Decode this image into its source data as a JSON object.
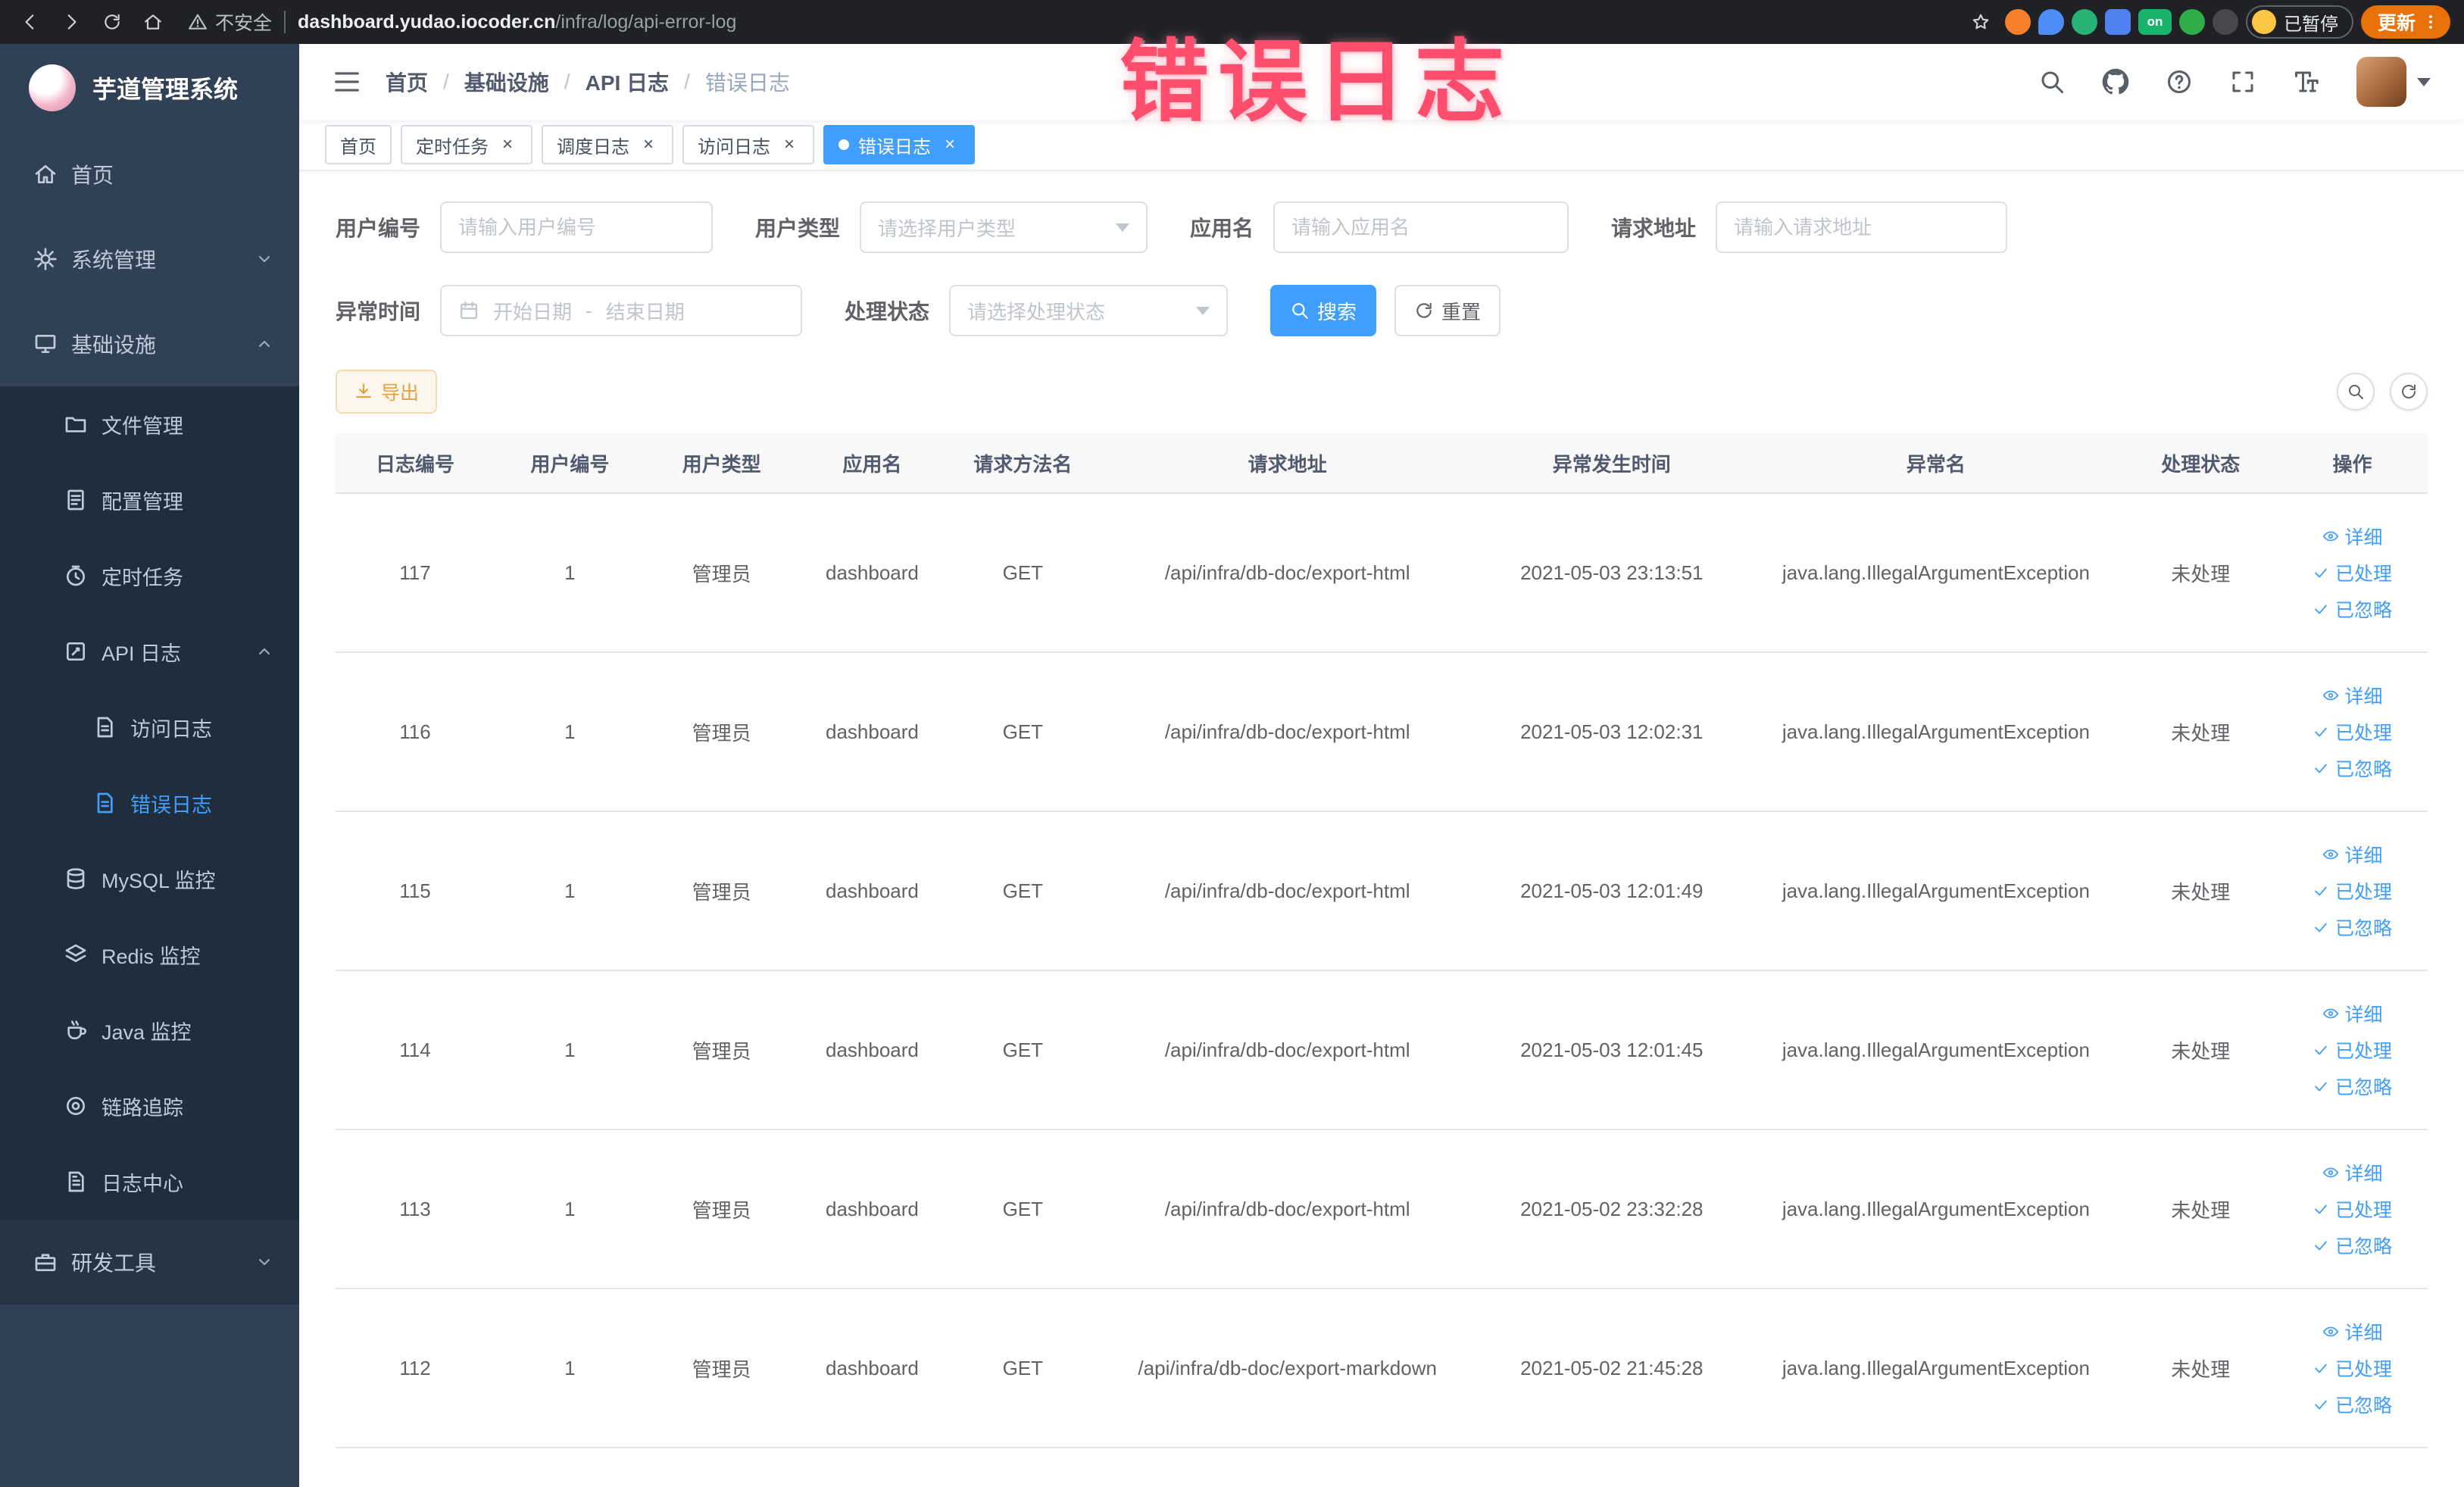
{
  "browser": {
    "security_label": "不安全",
    "url_host": "dashboard.yudao.iocoder.cn",
    "url_path": "/infra/log/api-error-log",
    "extension_on_label": "on",
    "profile_badge": "已暂停",
    "update_button": "更新"
  },
  "overlay_title": "错误日志",
  "sidebar": {
    "app_title": "芋道管理系统",
    "menu": [
      {
        "label": "首页",
        "icon": "home-icon",
        "level": 1
      },
      {
        "label": "系统管理",
        "icon": "gear-icon",
        "level": 1,
        "arrow": "down"
      },
      {
        "label": "基础设施",
        "icon": "infra-icon",
        "level": 1,
        "arrow": "up"
      },
      {
        "label": "文件管理",
        "icon": "folder-icon",
        "level": 2
      },
      {
        "label": "配置管理",
        "icon": "config-icon",
        "level": 2
      },
      {
        "label": "定时任务",
        "icon": "timer-icon",
        "level": 2
      },
      {
        "label": "API 日志",
        "icon": "api-log-icon",
        "level": 2,
        "arrow": "up"
      },
      {
        "label": "访问日志",
        "icon": "doc-icon",
        "level": 3
      },
      {
        "label": "错误日志",
        "icon": "doc-icon",
        "level": 3,
        "active": true
      },
      {
        "label": "MySQL 监控",
        "icon": "database-icon",
        "level": 2
      },
      {
        "label": "Redis 监控",
        "icon": "layers-icon",
        "level": 2
      },
      {
        "label": "Java 监控",
        "icon": "java-icon",
        "level": 2
      },
      {
        "label": "链路追踪",
        "icon": "trace-icon",
        "level": 2
      },
      {
        "label": "日志中心",
        "icon": "log-icon",
        "level": 2
      },
      {
        "label": "研发工具",
        "icon": "tools-icon",
        "level": 1,
        "arrow": "down",
        "variant": "dark"
      }
    ]
  },
  "breadcrumb": [
    {
      "label": "首页"
    },
    {
      "label": "基础设施"
    },
    {
      "label": "API 日志"
    },
    {
      "label": "错误日志",
      "current": true
    }
  ],
  "tabs": [
    {
      "label": "首页",
      "closable": false,
      "active": false
    },
    {
      "label": "定时任务",
      "closable": true,
      "active": false
    },
    {
      "label": "调度日志",
      "closable": true,
      "active": false
    },
    {
      "label": "访问日志",
      "closable": true,
      "active": false
    },
    {
      "label": "错误日志",
      "closable": true,
      "active": true
    }
  ],
  "filters": {
    "user_id_label": "用户编号",
    "user_id_placeholder": "请输入用户编号",
    "user_type_label": "用户类型",
    "user_type_placeholder": "请选择用户类型",
    "app_name_label": "应用名",
    "app_name_placeholder": "请输入应用名",
    "request_url_label": "请求地址",
    "request_url_placeholder": "请输入请求地址",
    "time_label": "异常时间",
    "time_start_placeholder": "开始日期",
    "time_separator": "-",
    "time_end_placeholder": "结束日期",
    "status_label": "处理状态",
    "status_placeholder": "请选择处理状态",
    "search_button": "搜索",
    "reset_button": "重置"
  },
  "toolbar": {
    "export_button": "导出"
  },
  "table": {
    "columns": [
      "日志编号",
      "用户编号",
      "用户类型",
      "应用名",
      "请求方法名",
      "请求地址",
      "异常发生时间",
      "异常名",
      "处理状态",
      "操作"
    ],
    "action_labels": {
      "detail": "详细",
      "processed": "已处理",
      "ignored": "已忽略"
    },
    "rows": [
      {
        "log_id": "117",
        "user_id": "1",
        "user_type": "管理员",
        "app_name": "dashboard",
        "method": "GET",
        "url": "/api/infra/db-doc/export-html",
        "time": "2021-05-03 23:13:51",
        "exception": "java.lang.IllegalArgumentException",
        "status": "未处理"
      },
      {
        "log_id": "116",
        "user_id": "1",
        "user_type": "管理员",
        "app_name": "dashboard",
        "method": "GET",
        "url": "/api/infra/db-doc/export-html",
        "time": "2021-05-03 12:02:31",
        "exception": "java.lang.IllegalArgumentException",
        "status": "未处理"
      },
      {
        "log_id": "115",
        "user_id": "1",
        "user_type": "管理员",
        "app_name": "dashboard",
        "method": "GET",
        "url": "/api/infra/db-doc/export-html",
        "time": "2021-05-03 12:01:49",
        "exception": "java.lang.IllegalArgumentException",
        "status": "未处理"
      },
      {
        "log_id": "114",
        "user_id": "1",
        "user_type": "管理员",
        "app_name": "dashboard",
        "method": "GET",
        "url": "/api/infra/db-doc/export-html",
        "time": "2021-05-03 12:01:45",
        "exception": "java.lang.IllegalArgumentException",
        "status": "未处理"
      },
      {
        "log_id": "113",
        "user_id": "1",
        "user_type": "管理员",
        "app_name": "dashboard",
        "method": "GET",
        "url": "/api/infra/db-doc/export-html",
        "time": "2021-05-02 23:32:28",
        "exception": "java.lang.IllegalArgumentException",
        "status": "未处理"
      },
      {
        "log_id": "112",
        "user_id": "1",
        "user_type": "管理员",
        "app_name": "dashboard",
        "method": "GET",
        "url": "/api/infra/db-doc/export-markdown",
        "time": "2021-05-02 21:45:28",
        "exception": "java.lang.IllegalArgumentException",
        "status": "未处理"
      }
    ]
  },
  "colors": {
    "accent": "#409eff",
    "warning": "#e6a23c",
    "sidebar_bg": "#304156",
    "submenu_bg": "#1f2d3d",
    "overlay_pink": "#ff4e6d",
    "update_orange": "#e8710a"
  }
}
